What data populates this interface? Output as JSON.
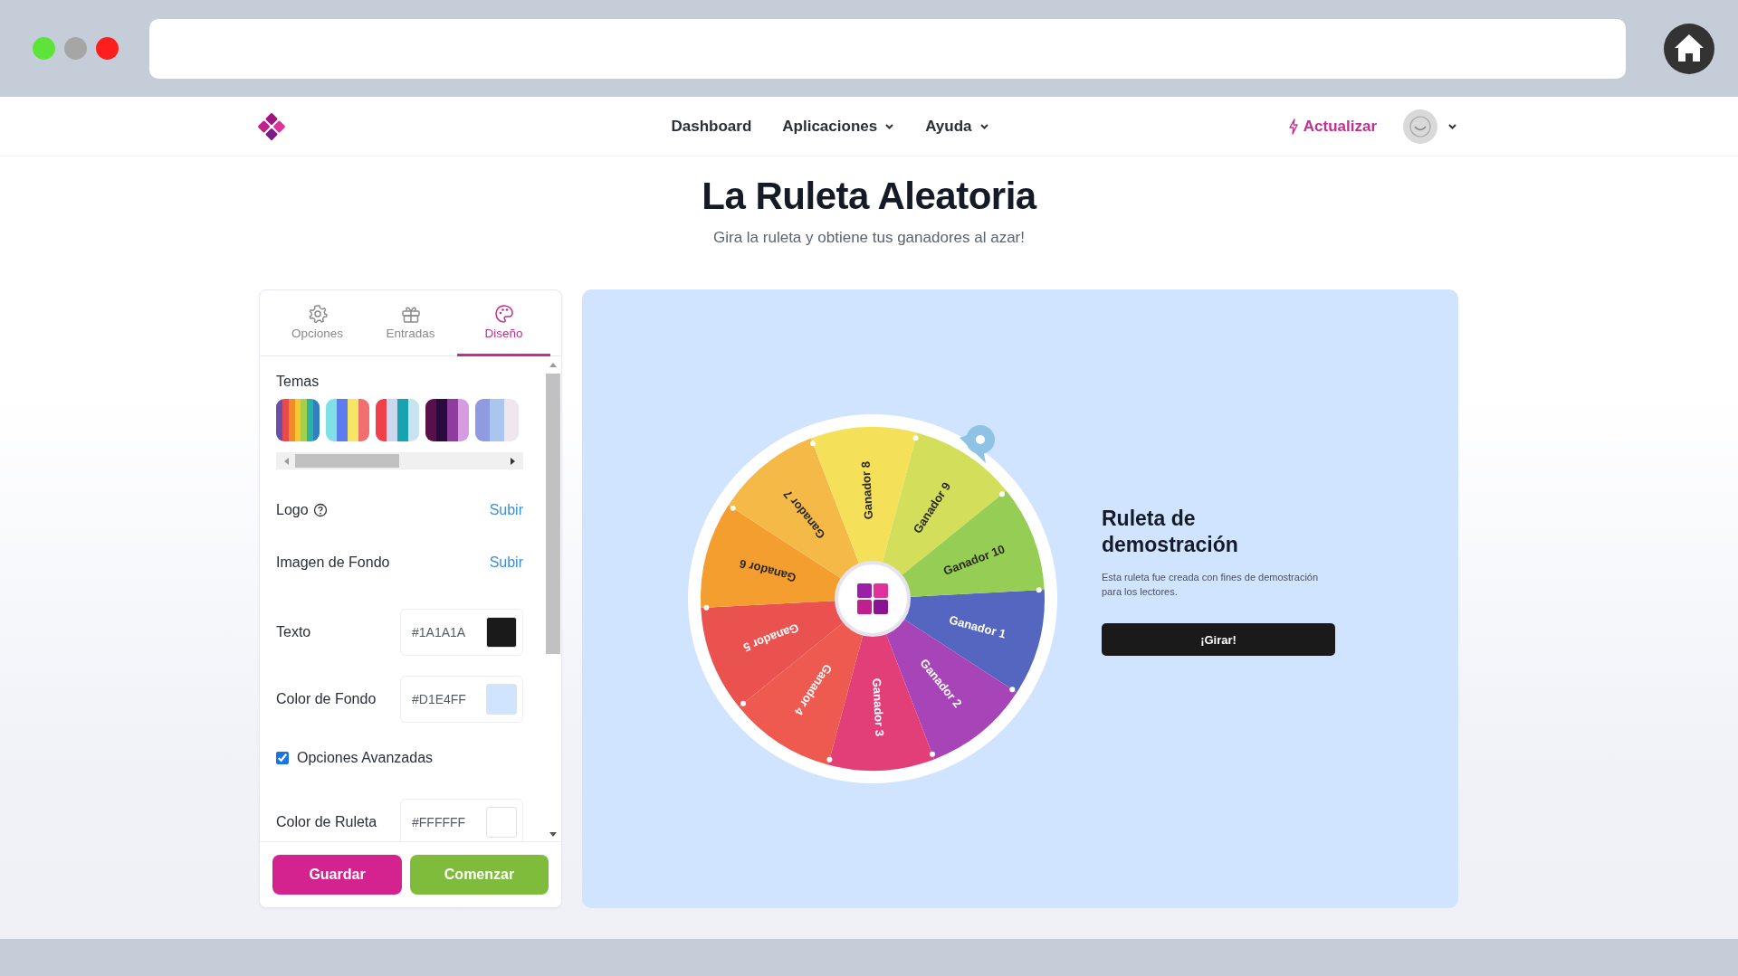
{
  "browser": {
    "traffic_lights": [
      {
        "color": "#5ee33a"
      },
      {
        "color": "#a6a6a6"
      },
      {
        "color": "#ff1e1e"
      }
    ]
  },
  "nav": {
    "links": [
      {
        "label": "Dashboard",
        "dropdown": false
      },
      {
        "label": "Aplicaciones",
        "dropdown": true
      },
      {
        "label": "Ayuda",
        "dropdown": true
      }
    ],
    "upgrade": "Actualizar"
  },
  "hero": {
    "title": "La Ruleta Aleatoria",
    "subtitle": "Gira la ruleta y obtiene tus ganadores al azar!"
  },
  "panel": {
    "tabs": [
      {
        "label": "Opciones",
        "selected": false
      },
      {
        "label": "Entradas",
        "selected": false
      },
      {
        "label": "Diseño",
        "selected": true
      }
    ],
    "themes_label": "Temas",
    "themes": [
      {
        "stripes": [
          {
            "color": "#6a4ea8"
          },
          {
            "color": "#e94b4b"
          },
          {
            "color": "#f58a2a"
          },
          {
            "color": "#f8c630"
          },
          {
            "color": "#a6d04a"
          },
          {
            "color": "#2bb3a0"
          },
          {
            "color": "#2f7fc1"
          }
        ]
      },
      {
        "stripes": [
          {
            "color": "#7fe0e6"
          },
          {
            "color": "#5c7cf0"
          },
          {
            "color": "#f5e664"
          },
          {
            "color": "#f07070"
          }
        ]
      },
      {
        "stripes": [
          {
            "color": "#f0404a"
          },
          {
            "color": "#c9d8ee"
          },
          {
            "color": "#18a3b0"
          },
          {
            "color": "#c9e3f0"
          }
        ]
      },
      {
        "stripes": [
          {
            "color": "#5a0f4a"
          },
          {
            "color": "#2b0a3d"
          },
          {
            "color": "#8e3d9e"
          },
          {
            "color": "#d69be0"
          }
        ]
      },
      {
        "stripes": [
          {
            "color": "#8e9be0"
          },
          {
            "color": "#a9c7ee"
          },
          {
            "color": "#f0e6ee"
          }
        ]
      }
    ],
    "rows": [
      {
        "kind": "upload",
        "label": "Logo",
        "help": true,
        "action": "Subir"
      },
      {
        "kind": "upload",
        "label": "Imagen de Fondo",
        "help": false,
        "action": "Subir"
      },
      {
        "kind": "color",
        "label": "Texto",
        "value": "#1A1A1A",
        "color": "#1a1a1a"
      },
      {
        "kind": "color",
        "label": "Color de Fondo",
        "value": "#D1E4FF",
        "color": "#d1e4ff"
      },
      {
        "kind": "checkbox",
        "label": "Opciones Avanzadas",
        "checked": true
      },
      {
        "kind": "color",
        "label": "Color de Ruleta",
        "value": "#FFFFFF",
        "color": "#ffffff"
      }
    ],
    "buttons": [
      {
        "label": "Guardar",
        "kind": "save"
      },
      {
        "label": "Comenzar",
        "kind": "start"
      }
    ]
  },
  "preview": {
    "segments": [
      {
        "label": "Ganador 1",
        "color": "#5566c0",
        "kind": "light"
      },
      {
        "label": "Ganador 2",
        "color": "#a745b8",
        "kind": "light"
      },
      {
        "label": "Ganador 3",
        "color": "#e23f78",
        "kind": "light"
      },
      {
        "label": "Ganador 4",
        "color": "#ee5a50",
        "kind": "light"
      },
      {
        "label": "Ganador 5",
        "color": "#e9524f",
        "kind": "light"
      },
      {
        "label": "Ganador 6",
        "color": "#f59e30",
        "kind": "dark"
      },
      {
        "label": "Ganador 7",
        "color": "#f5b948",
        "kind": "dark"
      },
      {
        "label": "Ganador 8",
        "color": "#f5e05a",
        "kind": "dark"
      },
      {
        "label": "Ganador 9",
        "color": "#d3df5a",
        "kind": "dark"
      },
      {
        "label": "Ganador 10",
        "color": "#96cd55",
        "kind": "dark"
      }
    ],
    "title": "Ruleta de demostración",
    "description": "Esta ruleta fue creada con fines de demostración para los lectores.",
    "button": "¡Girar!"
  }
}
